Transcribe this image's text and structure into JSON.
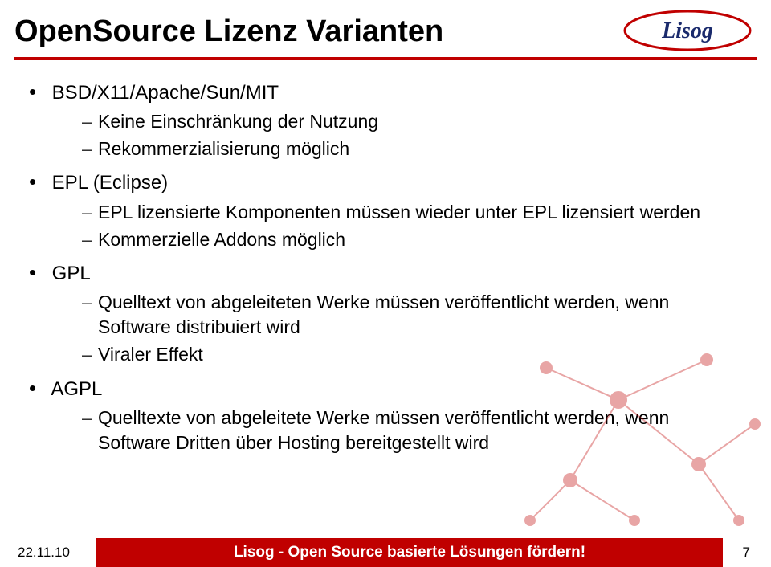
{
  "title": "OpenSource Lizenz Varianten",
  "logo": {
    "text": "Lisog"
  },
  "body": {
    "items": [
      {
        "label": "BSD/X11/Apache/Sun/MIT",
        "sub": [
          "Keine Einschränkung der Nutzung",
          "Rekommerzialisierung möglich"
        ]
      },
      {
        "label": "EPL (Eclipse)",
        "sub": [
          "EPL lizensierte Komponenten müssen wieder unter EPL lizensiert werden",
          "Kommerzielle Addons möglich"
        ]
      },
      {
        "label": "GPL",
        "sub": [
          "Quelltext von abgeleiteten Werke müssen veröffentlicht werden, wenn Software distribuiert wird",
          "Viraler Effekt"
        ]
      },
      {
        "label": "AGPL",
        "sub": [
          "Quelltexte von abgeleitete Werke müssen veröffentlicht werden, wenn Software Dritten über Hosting bereitgestellt wird"
        ]
      }
    ]
  },
  "footer": {
    "date": "22.11.10",
    "center": "Lisog - Open Source basierte Lösungen fördern!",
    "page": "7"
  },
  "colors": {
    "accent": "#c00000"
  }
}
